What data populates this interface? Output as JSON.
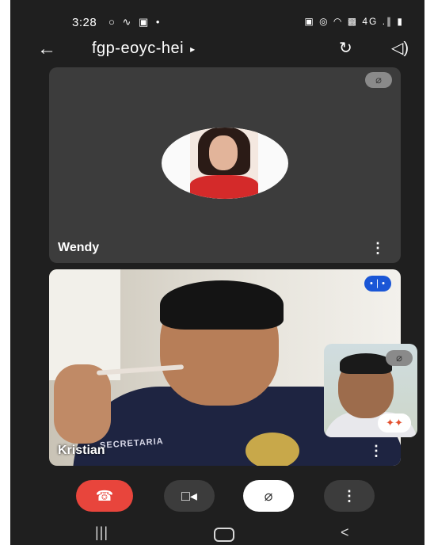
{
  "status_bar": {
    "time": "3:28",
    "left_icons": "○ ∿ ▣ •",
    "right_icons": "▣ ◎ ◠ ▩ 4G .∥ ▮"
  },
  "header": {
    "back_icon": "←",
    "title": "fgp-eoyc-hei",
    "title_caret": "▸",
    "camera_switch_icon": "↻",
    "speaker_icon": "◁)"
  },
  "participants": [
    {
      "name": "Wendy",
      "muted": true,
      "muted_icon": "⌀",
      "menu_icon": "⋮"
    },
    {
      "name": "Kristian",
      "speaking": true,
      "speaking_icon": "•❘•",
      "menu_icon": "⋮",
      "shirt_text": "SECRETARIA"
    }
  ],
  "self_view": {
    "muted_icon": "⌀",
    "effects_icon": "✦✦"
  },
  "controls": {
    "end_call_icon": "☎",
    "camera_icon": "□◂",
    "mic_icon": "⌀",
    "more_icon": "⋮"
  },
  "nav": {
    "recents_icon": "|||",
    "back_icon": "<"
  },
  "colors": {
    "background": "#1f1f1f",
    "tile": "#3c3c3c",
    "end_call": "#e8453c",
    "speaking": "#1a56d6"
  }
}
